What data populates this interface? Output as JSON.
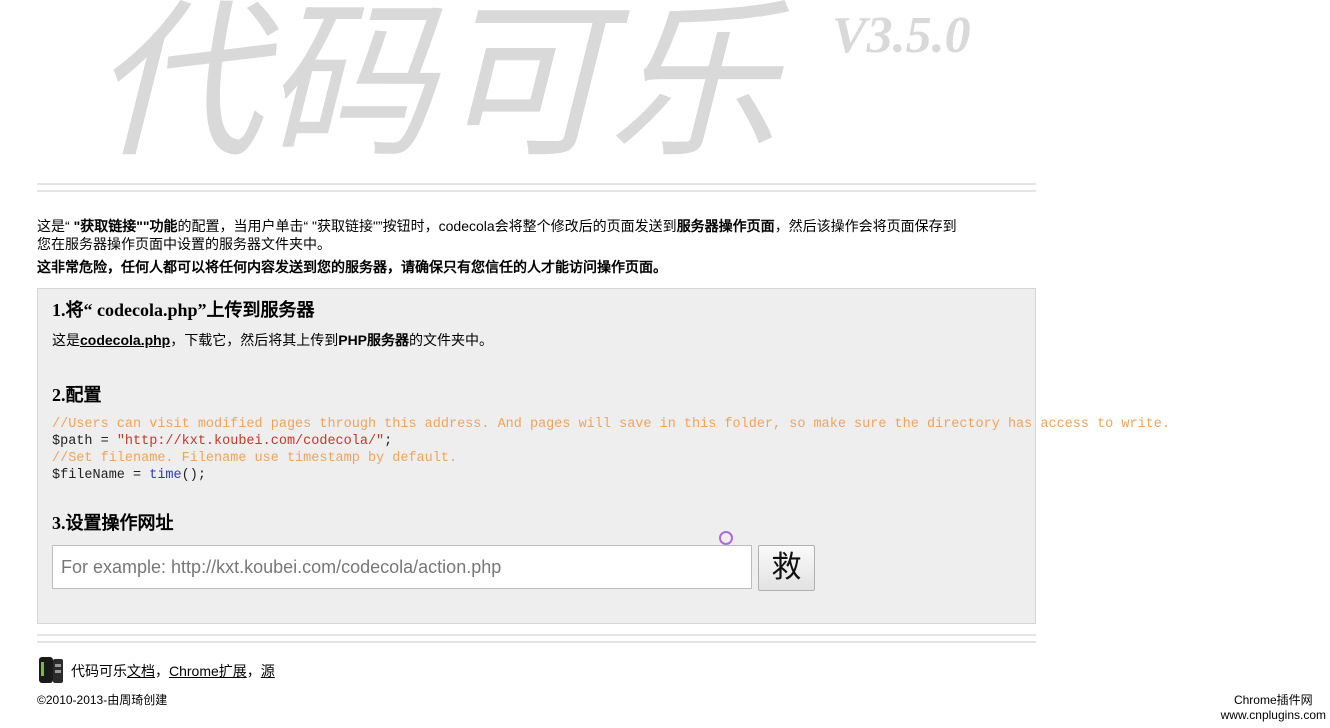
{
  "logo": {
    "text": "代码可乐",
    "version": "V3.5.0"
  },
  "intro": {
    "p1_a": "这是“ ",
    "p1_b": "\"获取链接\"",
    "p1_c": "\"功能",
    "p1_d": "的配置，当用户单击“ \"获取链接\"”按钮时，codecola会将整个修改后的页面发送到",
    "p1_e": "服务器操作页面",
    "p1_f": "，然后该操作会将页面保存到",
    "p2": "您在服务器操作页面中设置的服务器文件夹中。",
    "warning": "这非常危险，任何人都可以将任何内容发送到您的服务器，请确保只有您信任的人才能访问操作页面。"
  },
  "steps": {
    "s1_title": "1.将“ codecola.php”上传到服务器",
    "s1_a": "这是",
    "s1_link": "codecola.php",
    "s1_b": "，下载它，然后将其上传到",
    "s1_c": "PHP服务器",
    "s1_d": "的文件夹中。",
    "s2_title": "2.配置",
    "code": {
      "c1": "//Users can visit modified pages through this address. And pages will save in this folder, so make sure the directory has access to write.",
      "l2_a": "$path = ",
      "l2_str": "\"http://kxt.koubei.com/codecola/\"",
      "l2_b": ";",
      "c3": "//Set filename. Filename use timestamp by default.",
      "l4_a": "$fileName = ",
      "l4_fn": "time",
      "l4_b": "();"
    },
    "s3_title": "3.设置操作网址",
    "input_placeholder": "For example: http://kxt.koubei.com/codecola/action.php",
    "input_value": "",
    "save_label": "救"
  },
  "footer": {
    "brand": "代码可乐",
    "docs": "文档",
    "sep1": "，",
    "chrome": "Chrome扩展",
    "sep2": "，",
    "source": "源",
    "copyright": "©2010-2013-由",
    "author": "周琦",
    "created": "创建"
  },
  "watermark": {
    "line1": "Chrome插件网",
    "line2": "www.cnplugins.com"
  },
  "colors": {
    "comment": "#f0a45a",
    "string": "#c0392b",
    "function": "#2a3bbf",
    "panel_bg": "#eeeeee",
    "logo": "#d9d9d9"
  }
}
